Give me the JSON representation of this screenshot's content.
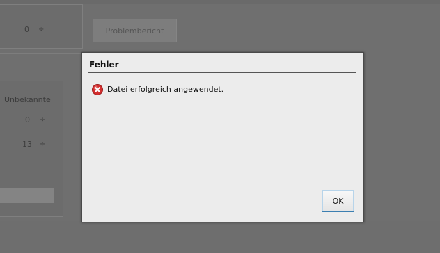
{
  "background": {
    "stepper_top_value": "0",
    "problem_report_label": "Problembericht",
    "unknown_header": "Unbekannte",
    "unknown_value_1": "0",
    "unknown_value_2": "13",
    "stepper_symbol": "÷"
  },
  "dialog": {
    "title": "Fehler",
    "message": "Datei erfolgreich angewendet.",
    "ok_label": "OK",
    "icon": "error-icon"
  },
  "colors": {
    "overlay": "#6f6f6f",
    "dialog_bg": "#ececec",
    "error_red": "#d32f2f",
    "ok_border": "#3c7fb1"
  }
}
